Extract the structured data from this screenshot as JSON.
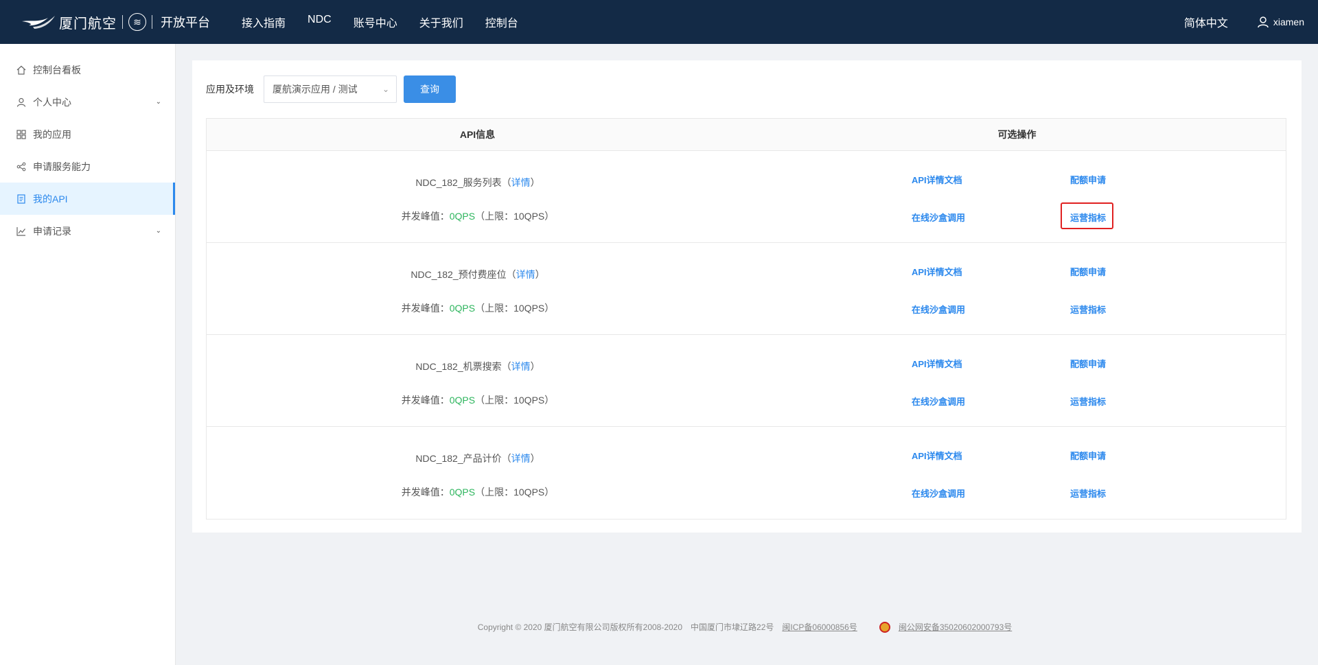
{
  "topbar": {
    "logo_text": "厦门航空",
    "logo_platform": "开放平台",
    "nav": [
      "接入指南",
      "NDC",
      "账号中心",
      "关于我们",
      "控制台"
    ],
    "language": "简体中文",
    "username": "xiamen"
  },
  "sidebar": {
    "items": [
      {
        "label": "控制台看板",
        "icon": "home-icon"
      },
      {
        "label": "个人中心",
        "icon": "user-icon",
        "expandable": true
      },
      {
        "label": "我的应用",
        "icon": "grid-icon"
      },
      {
        "label": "申请服务能力",
        "icon": "share-icon"
      },
      {
        "label": "我的API",
        "icon": "document-icon",
        "active": true
      },
      {
        "label": "申请记录",
        "icon": "chart-icon",
        "expandable": true
      }
    ]
  },
  "filter": {
    "label": "应用及环境",
    "selected": "厦航演示应用 / 测试",
    "query_button": "查询"
  },
  "table": {
    "headers": {
      "api": "API信息",
      "ops": "可选操作"
    },
    "qps_prefix": "并发峰值：",
    "qps_value": "0QPS",
    "qps_suffix": "（上限：10QPS）",
    "detail_open": "（",
    "detail_link": "详情",
    "detail_close": "）",
    "ops": {
      "doc": "API详情文档",
      "quota": "配额申请",
      "sandbox": "在线沙盒调用",
      "metrics": "运营指标"
    },
    "rows": [
      {
        "name": "NDC_182_服务列表"
      },
      {
        "name": "NDC_182_预付费座位"
      },
      {
        "name": "NDC_182_机票搜索"
      },
      {
        "name": "NDC_182_产品计价"
      }
    ]
  },
  "footer": {
    "copyright": "Copyright © 2020 厦门航空有限公司版权所有2008-2020",
    "address": "中国厦门市埭辽路22号",
    "icp": "闽ICP备06000856号",
    "police": "闽公网安备35020602000793号"
  },
  "colors": {
    "nav_bg": "#132a46",
    "accent": "#2b88ed",
    "qps_green": "#2db55d",
    "highlight_red": "#e02020"
  }
}
